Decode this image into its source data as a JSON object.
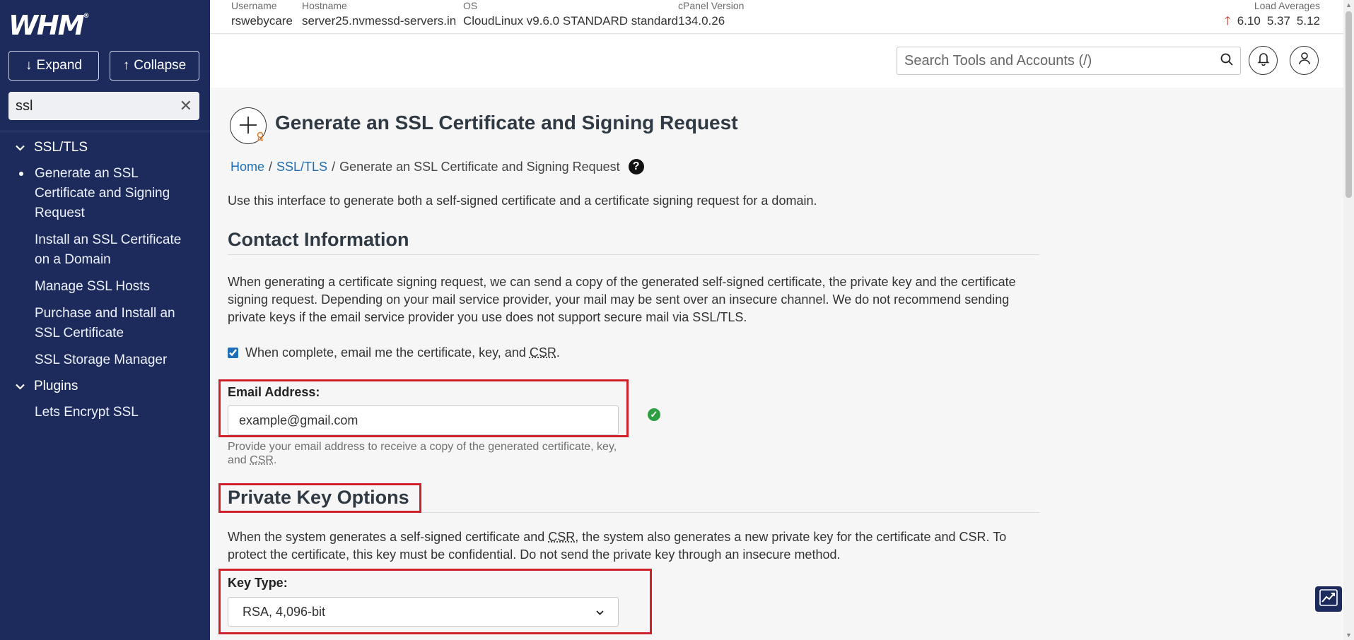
{
  "app": {
    "logo": "WHM",
    "logo_mark": "®"
  },
  "sidebar": {
    "expand_label": "Expand",
    "collapse_label": "Collapse",
    "search_value": "ssl",
    "groups": [
      {
        "label": "SSL/TLS"
      },
      {
        "label": "Plugins"
      }
    ],
    "items": [
      {
        "label": "Generate an SSL Certificate and Signing Request"
      },
      {
        "label": "Install an SSL Certificate on a Domain"
      },
      {
        "label": "Manage SSL Hosts"
      },
      {
        "label": "Purchase and Install an SSL Certificate"
      },
      {
        "label": "SSL Storage Manager"
      },
      {
        "label": "Lets Encrypt SSL"
      }
    ]
  },
  "header": {
    "username_label": "Username",
    "username": "rswebycare",
    "hostname_label": "Hostname",
    "hostname": "server25.nvmessd-servers.in",
    "os_label": "OS",
    "os": "CloudLinux v9.6.0 STANDARD standard",
    "cpanel_label": "cPanel Version",
    "cpanel": "134.0.26",
    "load_label": "Load Averages",
    "load": [
      "6.10",
      "5.37",
      "5.12"
    ]
  },
  "toolbar": {
    "search_placeholder": "Search Tools and Accounts (/)"
  },
  "page": {
    "title": "Generate an SSL Certificate and Signing Request",
    "breadcrumb": {
      "home": "Home",
      "sep": "/",
      "section": "SSL/TLS",
      "current": "Generate an SSL Certificate and Signing Request"
    },
    "help_glyph": "?",
    "description": "Use this interface to generate both a self-signed certificate and a certificate signing request for a domain.",
    "contact": {
      "title": "Contact Information",
      "para": "When generating a certificate signing request, we can send a copy of the generated self-signed certificate, the private key and the certificate signing request. Depending on your mail service provider, your mail may be sent over an insecure channel. We do not recommend sending private keys if the email service provider you use does not support secure mail via SSL/TLS.",
      "checkbox_label_pre": "When complete, email me the certificate, key, and ",
      "checkbox_abbr": "CSR",
      "checkbox_label_post": ".",
      "email_label": "Email Address:",
      "email_value": "example@gmail.com",
      "email_help_pre": "Provide your email address to receive a copy of the generated certificate, key, and ",
      "email_help_abbr": "CSR",
      "email_help_post": "."
    },
    "private_key": {
      "title": "Private Key Options",
      "para_pre": "When the system generates a self-signed certificate and ",
      "para_abbr": "CSR",
      "para_post": ", the system also generates a new private key for the certificate and CSR. To protect the certificate, this key must be confidential. Do not send the private key through an insecure method.",
      "key_type_label": "Key Type:",
      "key_type_value": "RSA, 4,096-bit"
    }
  }
}
